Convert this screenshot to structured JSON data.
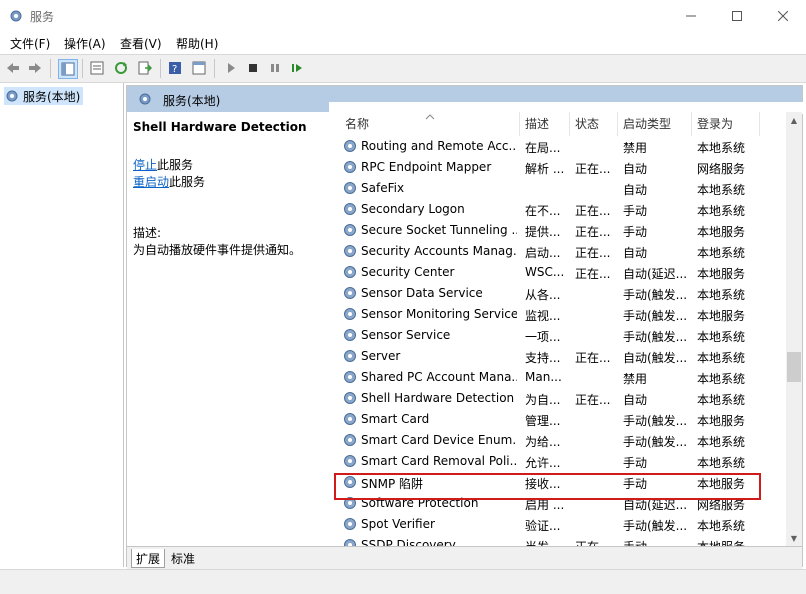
{
  "window": {
    "title": "服务"
  },
  "menu": [
    "文件(F)",
    "操作(A)",
    "查看(V)",
    "帮助(H)"
  ],
  "tree": {
    "root_label": "服务(本地)"
  },
  "panel": {
    "header": "服务(本地)"
  },
  "detail": {
    "service_title": "Shell Hardware Detection",
    "stop_link": "停止",
    "stop_suffix": "此服务",
    "restart_link": "重启动",
    "restart_suffix": "此服务",
    "desc_label": "描述:",
    "desc_text": "为自动播放硬件事件提供通知。"
  },
  "columns": {
    "name": "名称",
    "desc": "描述",
    "status": "状态",
    "startup": "启动类型",
    "logon": "登录为"
  },
  "services": [
    {
      "name": "Routing and Remote Acc...",
      "desc": "在局...",
      "status": "",
      "startup": "禁用",
      "logon": "本地系统"
    },
    {
      "name": "RPC Endpoint Mapper",
      "desc": "解析 ...",
      "status": "正在...",
      "startup": "自动",
      "logon": "网络服务"
    },
    {
      "name": "SafeFix",
      "desc": "",
      "status": "",
      "startup": "自动",
      "logon": "本地系统"
    },
    {
      "name": "Secondary Logon",
      "desc": "在不...",
      "status": "正在...",
      "startup": "手动",
      "logon": "本地系统"
    },
    {
      "name": "Secure Socket Tunneling ...",
      "desc": "提供...",
      "status": "正在...",
      "startup": "手动",
      "logon": "本地服务"
    },
    {
      "name": "Security Accounts Manag...",
      "desc": "启动...",
      "status": "正在...",
      "startup": "自动",
      "logon": "本地系统"
    },
    {
      "name": "Security Center",
      "desc": "WSC...",
      "status": "正在...",
      "startup": "自动(延迟...",
      "logon": "本地服务"
    },
    {
      "name": "Sensor Data Service",
      "desc": "从各...",
      "status": "",
      "startup": "手动(触发...",
      "logon": "本地系统"
    },
    {
      "name": "Sensor Monitoring Service",
      "desc": "监视...",
      "status": "",
      "startup": "手动(触发...",
      "logon": "本地服务"
    },
    {
      "name": "Sensor Service",
      "desc": "一项...",
      "status": "",
      "startup": "手动(触发...",
      "logon": "本地系统"
    },
    {
      "name": "Server",
      "desc": "支持...",
      "status": "正在...",
      "startup": "自动(触发...",
      "logon": "本地系统"
    },
    {
      "name": "Shared PC Account Mana...",
      "desc": "Man...",
      "status": "",
      "startup": "禁用",
      "logon": "本地系统"
    },
    {
      "name": "Shell Hardware Detection",
      "desc": "为自...",
      "status": "正在...",
      "startup": "自动",
      "logon": "本地系统"
    },
    {
      "name": "Smart Card",
      "desc": "管理...",
      "status": "",
      "startup": "手动(触发...",
      "logon": "本地服务"
    },
    {
      "name": "Smart Card Device Enum...",
      "desc": "为给...",
      "status": "",
      "startup": "手动(触发...",
      "logon": "本地系统"
    },
    {
      "name": "Smart Card Removal Poli...",
      "desc": "允许...",
      "status": "",
      "startup": "手动",
      "logon": "本地系统"
    },
    {
      "name": "SNMP 陷阱",
      "desc": "接收...",
      "status": "",
      "startup": "手动",
      "logon": "本地服务"
    },
    {
      "name": "Software Protection",
      "desc": "启用 ...",
      "status": "",
      "startup": "自动(延迟...",
      "logon": "网络服务"
    },
    {
      "name": "Spot Verifier",
      "desc": "验证...",
      "status": "",
      "startup": "手动(触发...",
      "logon": "本地系统"
    },
    {
      "name": "SSDP Discovery",
      "desc": "当发...",
      "status": "正在...",
      "startup": "手动",
      "logon": "本地服务"
    }
  ],
  "tabs": [
    "扩展",
    "标准"
  ],
  "colors": {
    "panel_header": "#b6cbe4",
    "highlight_border": "#d11a1a",
    "link": "#0b63c5"
  }
}
